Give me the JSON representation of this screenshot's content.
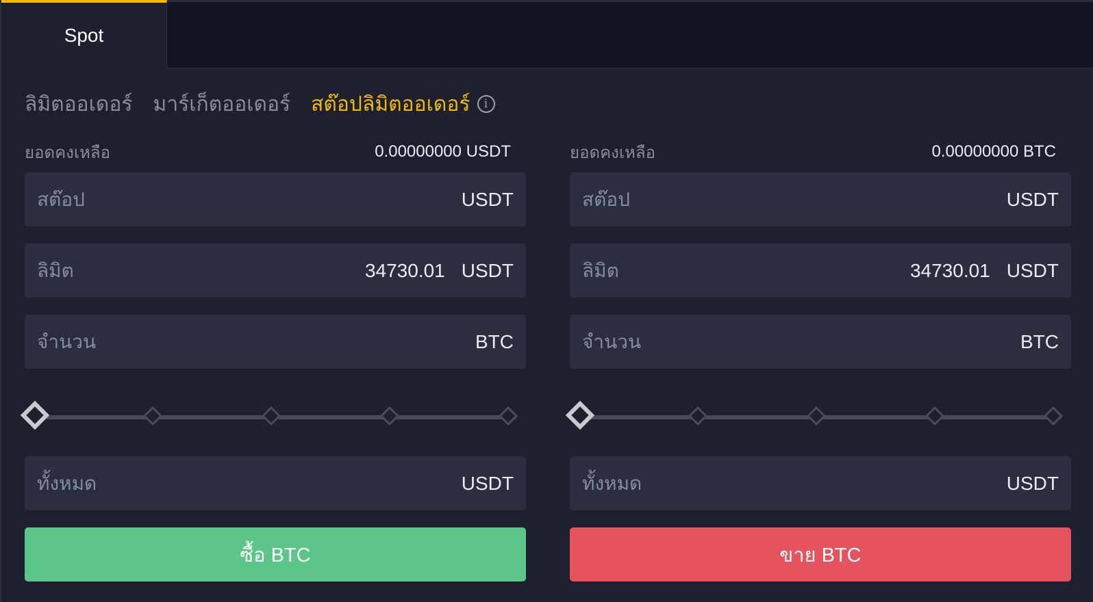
{
  "tabs": {
    "active": "Spot"
  },
  "order_types": [
    {
      "label": "ลิมิตออเดอร์",
      "active": false
    },
    {
      "label": "มาร์เก็ตออเดอร์",
      "active": false
    },
    {
      "label": "สต๊อปลิมิตออเดอร์",
      "active": true
    }
  ],
  "info_icon_glyph": "i",
  "buy": {
    "balance_label": "ยอดคงเหลือ",
    "balance_value": "0.00000000 USDT",
    "stop_label": "สต๊อป",
    "stop_unit": "USDT",
    "limit_label": "ลิมิต",
    "limit_value": "34730.01",
    "limit_unit": "USDT",
    "amount_label": "จำนวน",
    "amount_unit": "BTC",
    "slider_level_percent": 0,
    "total_label": "ทั้งหมด",
    "total_unit": "USDT",
    "button_label": "ซื้อ BTC"
  },
  "sell": {
    "balance_label": "ยอดคงเหลือ",
    "balance_value": "0.00000000 BTC",
    "stop_label": "สต๊อป",
    "stop_unit": "USDT",
    "limit_label": "ลิมิต",
    "limit_value": "34730.01",
    "limit_unit": "USDT",
    "amount_label": "จำนวน",
    "amount_unit": "BTC",
    "slider_level_percent": 0,
    "total_label": "ทั้งหมด",
    "total_unit": "USDT",
    "button_label": "ขาย BTC"
  },
  "colors": {
    "accent": "#f0b90b",
    "buy": "#5cc689",
    "sell": "#e5535f",
    "background": "#1e2030",
    "field": "#2b2e3e"
  }
}
